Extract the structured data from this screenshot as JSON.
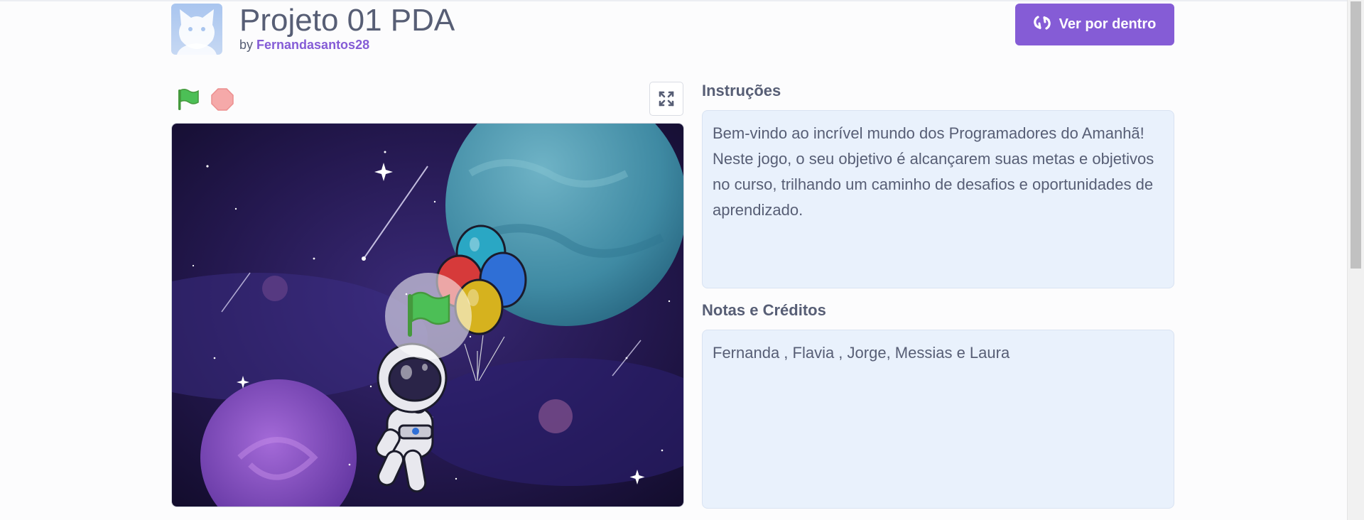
{
  "project": {
    "title": "Projeto 01 PDA",
    "by_label": "by",
    "author": "Fernandasantos28"
  },
  "header": {
    "see_inside_label": "Ver por dentro"
  },
  "instructions": {
    "heading": "Instruções",
    "text": "Bem-vindo ao incrível mundo dos Programadores do Amanhã! Neste jogo, o seu objetivo é alcançarem suas metas e objetivos no curso, trilhando um caminho de desafios e oportunidades de aprendizado."
  },
  "notes": {
    "heading": "Notas e Créditos",
    "text": "Fernanda , Flavia , Jorge, Messias e Laura"
  },
  "icons": {
    "avatar": "scratch-cat-avatar-icon",
    "see_inside": "remix-arrows-icon",
    "start": "green-flag-icon",
    "stop": "stop-sign-icon",
    "fullscreen": "fullscreen-expand-icon",
    "stage_overlay": "green-flag-play-icon"
  },
  "colors": {
    "accent": "#855cd6",
    "text": "#575e75",
    "panel": "#e9f1fc",
    "flag": "#4cbf56",
    "stop": "#ec5959"
  }
}
